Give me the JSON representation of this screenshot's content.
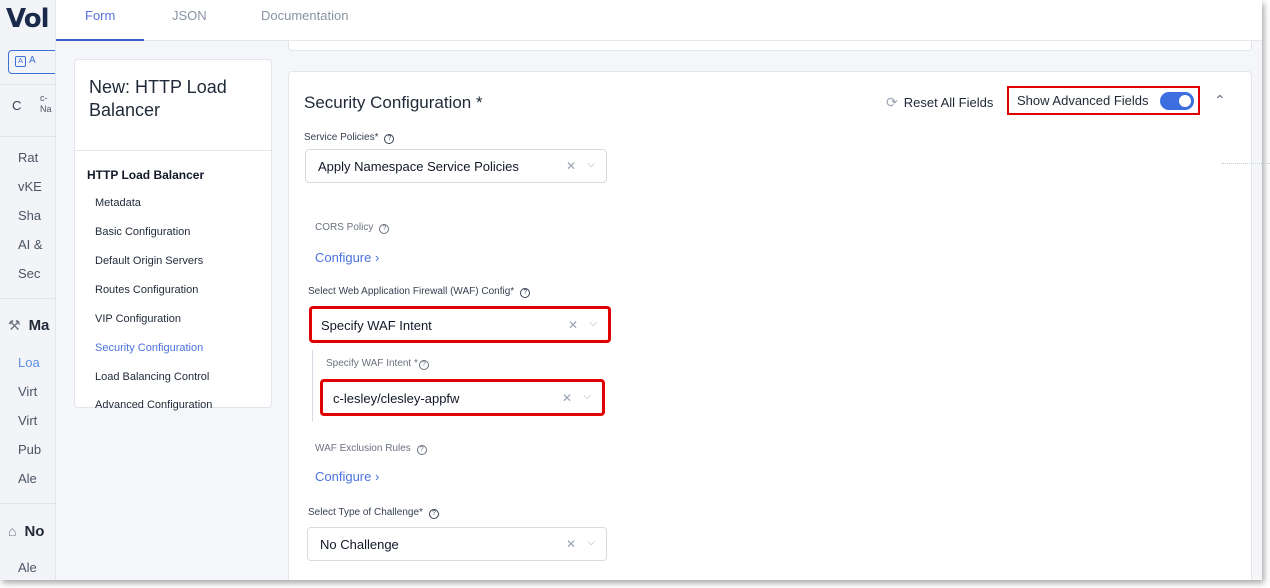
{
  "app": {
    "logo_text": "Vol",
    "top_button_label": "A",
    "namespace": {
      "initial": "C",
      "line1": "c-",
      "line2": "Na"
    }
  },
  "appnav": {
    "items_top": [
      "Rat",
      "vKE",
      "Sha",
      "AI &",
      "Sec"
    ],
    "section1": {
      "label": "Ma"
    },
    "items_mid": [
      {
        "label": "Loa",
        "active": true
      },
      {
        "label": "Virt",
        "active": false
      },
      {
        "label": "Virt",
        "active": false
      },
      {
        "label": "Pub",
        "active": false
      },
      {
        "label": "Ale",
        "active": false
      }
    ],
    "section2": {
      "label": "No"
    },
    "items_bottom": [
      "Ale"
    ]
  },
  "tabs": [
    {
      "label": "Form",
      "active": true
    },
    {
      "label": "JSON",
      "active": false
    },
    {
      "label": "Documentation",
      "active": false
    }
  ],
  "leftcard": {
    "title": "New: HTTP Load Balancer",
    "group": "HTTP Load Balancer",
    "links": [
      {
        "label": "Metadata",
        "active": false
      },
      {
        "label": "Basic Configuration",
        "active": false
      },
      {
        "label": "Default Origin Servers",
        "active": false
      },
      {
        "label": "Routes Configuration",
        "active": false
      },
      {
        "label": "VIP Configuration",
        "active": false
      },
      {
        "label": "Security Configuration",
        "active": true
      },
      {
        "label": "Load Balancing Control",
        "active": false
      },
      {
        "label": "Advanced Configuration",
        "active": false
      }
    ]
  },
  "security": {
    "title": "Security Configuration *",
    "reset_label": "Reset All Fields",
    "show_advanced_label": "Show Advanced Fields",
    "show_advanced_on": true,
    "service_policies": {
      "label": "Service Policies*",
      "value": "Apply Namespace Service Policies"
    },
    "cors": {
      "label": "CORS Policy",
      "configure": "Configure"
    },
    "waf_config": {
      "label": "Select Web Application Firewall (WAF) Config*",
      "value": "Specify WAF Intent"
    },
    "waf_intent": {
      "label": "Specify WAF Intent *",
      "value": "c-lesley/clesley-appfw"
    },
    "waf_exclusion": {
      "label": "WAF Exclusion Rules",
      "configure": "Configure"
    },
    "challenge": {
      "label": "Select Type of Challenge*",
      "value": "No Challenge"
    }
  },
  "icons": {
    "help": "?",
    "clear": "×",
    "chevron_down": "⌄",
    "chevron_right": "›",
    "chevron_up": "⌃",
    "refresh": "⟳",
    "wrench": "🔧",
    "bell": "🔔"
  },
  "colors": {
    "accent": "#3d6ee0",
    "highlight_border": "#e00000",
    "link": "#4b73e0"
  }
}
